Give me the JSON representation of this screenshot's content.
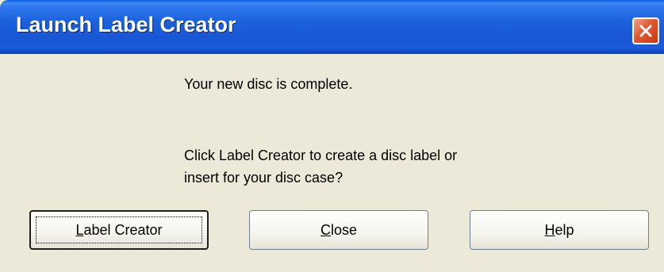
{
  "window": {
    "title": "Launch Label Creator"
  },
  "titlebar": {
    "close_icon": "close-icon",
    "close_color": "#E2572F",
    "title_color": "#FFFFFF"
  },
  "message": {
    "line1": "Your new disc is complete.",
    "line2": "Click Label Creator to create a disc label or",
    "line3": "insert for your disc case?"
  },
  "buttons": {
    "label_creator": {
      "accel": "L",
      "rest": "abel Creator"
    },
    "close": {
      "accel": "C",
      "rest": "lose"
    },
    "help": {
      "accel": "H",
      "rest": "elp"
    }
  }
}
